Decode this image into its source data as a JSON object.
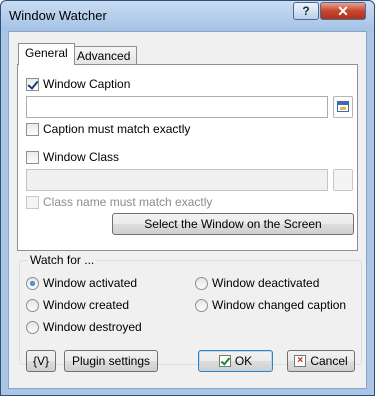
{
  "window": {
    "title": "Window Watcher",
    "help_symbol": "?",
    "close_symbol": "✕"
  },
  "tabs": {
    "general": "General",
    "advanced": "Advanced"
  },
  "general": {
    "window_caption_label": "Window Caption",
    "window_caption_checked": true,
    "window_caption_value": "",
    "caption_exact_label": "Caption must match exactly",
    "caption_exact_checked": false,
    "window_class_label": "Window Class",
    "window_class_checked": false,
    "window_class_value": "",
    "class_exact_label": "Class name must match exactly",
    "class_exact_checked": false,
    "select_window_button": "Select the Window on the Screen"
  },
  "watch_for": {
    "label": "Watch for ...",
    "options": [
      {
        "label": "Window activated",
        "selected": true
      },
      {
        "label": "Window deactivated",
        "selected": false
      },
      {
        "label": "Window created",
        "selected": false
      },
      {
        "label": "Window changed caption",
        "selected": false
      },
      {
        "label": "Window destroyed",
        "selected": false
      }
    ]
  },
  "footer": {
    "variables_button": "{V}",
    "plugin_settings_button": "Plugin settings",
    "ok_button": "OK",
    "cancel_button": "Cancel"
  }
}
